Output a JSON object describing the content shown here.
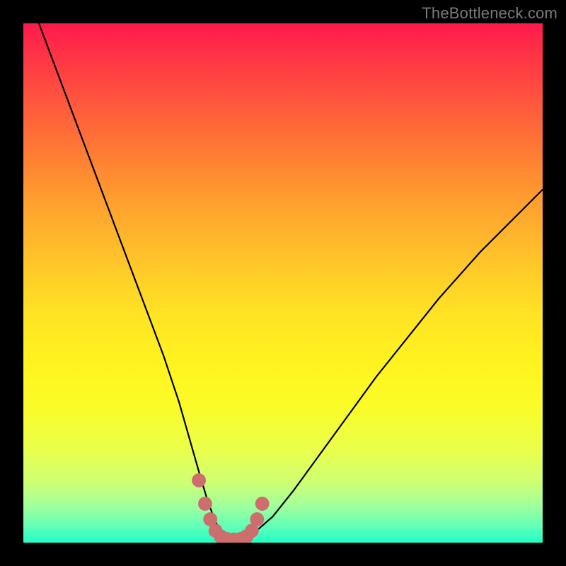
{
  "watermark": "TheBottleneck.com",
  "colors": {
    "frame": "#000000",
    "gradient_top": "#ff1a4d",
    "gradient_bottom": "#1effc8",
    "curve": "#000000",
    "marker": "#cc6e6e"
  },
  "chart_data": {
    "type": "line",
    "title": "",
    "xlabel": "",
    "ylabel": "",
    "xlim": [
      0,
      100
    ],
    "ylim": [
      0,
      100
    ],
    "series": [
      {
        "name": "bottleneck-curve",
        "x": [
          3,
          6,
          9,
          12,
          15,
          18,
          21,
          24,
          27,
          30,
          32,
          34,
          35.5,
          37,
          38.5,
          40,
          42,
          44,
          48,
          52,
          56,
          60,
          64,
          68,
          72,
          76,
          80,
          84,
          88,
          92,
          96,
          100
        ],
        "y": [
          100,
          92,
          84,
          76,
          68,
          60,
          52,
          44,
          36,
          27,
          20,
          13,
          8,
          4,
          1.5,
          0.5,
          0.5,
          1.5,
          5,
          10,
          15.5,
          21,
          26.5,
          32,
          37,
          42,
          47,
          51.5,
          56,
          60,
          64,
          68
        ]
      }
    ],
    "markers": {
      "name": "highlight-dots",
      "points": [
        {
          "x": 33.8,
          "y": 12
        },
        {
          "x": 35.0,
          "y": 7.5
        },
        {
          "x": 36.0,
          "y": 4.5
        },
        {
          "x": 37.0,
          "y": 2.3
        },
        {
          "x": 38.0,
          "y": 1.2
        },
        {
          "x": 39.2,
          "y": 0.7
        },
        {
          "x": 40.5,
          "y": 0.6
        },
        {
          "x": 41.8,
          "y": 0.7
        },
        {
          "x": 43.0,
          "y": 1.2
        },
        {
          "x": 44.0,
          "y": 2.3
        },
        {
          "x": 45.0,
          "y": 4.5
        },
        {
          "x": 46.0,
          "y": 7.5
        }
      ]
    }
  }
}
